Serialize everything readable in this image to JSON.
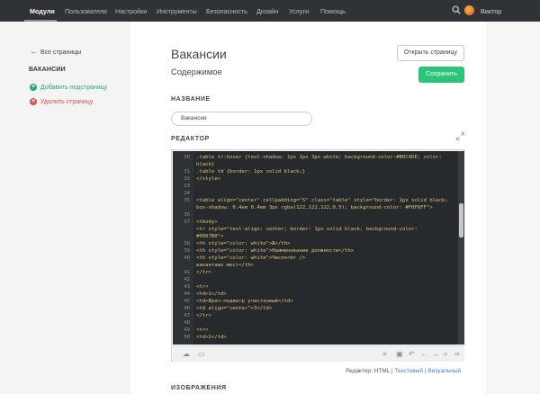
{
  "topnav": {
    "items": [
      "Модули",
      "Пользователи",
      "Настройки",
      "Инструменты",
      "Безопасность",
      "Дизайн",
      "Услуги",
      "Помощь"
    ],
    "active": "Модули",
    "user": "Виктор"
  },
  "sidebar": {
    "back": "Все страницы",
    "title": "ВАКАНСИИ",
    "add": "Добавить подстраницу",
    "delete": "Удалить страницу"
  },
  "page": {
    "title": "Вакансии",
    "subtitle": "Содержимое",
    "open_button": "Открыть страницу",
    "save_button": "Сохранить",
    "name_label": "НАЗВАНИЕ",
    "name_value": "Вакансии",
    "editor_label": "РЕДАКТОР",
    "images_label": "ИЗОБРАЖЕНИЯ"
  },
  "editor": {
    "lines": [
      {
        "n": "30",
        "t": ".table tr:hover {text-shadow: 1px 1px 3px white; background-color:#B0C4DE; color:"
      },
      {
        "n": "",
        "t": "black}"
      },
      {
        "n": "31",
        "t": ".table td {border: 1px solid black;}"
      },
      {
        "n": "32",
        "t": "</style>"
      },
      {
        "n": "33",
        "t": ""
      },
      {
        "n": "34",
        "t": ""
      },
      {
        "n": "35",
        "t": "<table align=\"center\" cellpadding=\"5\" class=\"table\" style=\"border: 1px solid black;"
      },
      {
        "n": "",
        "t": "box-shadow: 0.4em 0.4em 3px rgba(122,122,122,0.5); background-color: #F0F8FF\">"
      },
      {
        "n": "36",
        "t": ""
      },
      {
        "n": "37",
        "t": " <tbody>"
      },
      {
        "n": "",
        "t": " <tr style=\"text-align: center; border: 1px solid black; background-color:"
      },
      {
        "n": "",
        "t": "#0067B0\">"
      },
      {
        "n": "38",
        "t": "    <th style=\"color: white\">№</th>"
      },
      {
        "n": "39",
        "t": " <th style=\"color: white\">Наименование должности</th>"
      },
      {
        "n": "40",
        "t": " <th style=\"color: white\">Число<br />"
      },
      {
        "n": "",
        "t": " вакантных мест</th>"
      },
      {
        "n": "41",
        "t": " </tr>"
      },
      {
        "n": "42",
        "t": ""
      },
      {
        "n": "43",
        "t": " <tr>"
      },
      {
        "n": "44",
        "t": "    <td>1</td>"
      },
      {
        "n": "45",
        "t": " <td>Врач-педиатр участковый</td>"
      },
      {
        "n": "46",
        "t": " <td align=\"center\">3</td>"
      },
      {
        "n": "47",
        "t": " </tr>"
      },
      {
        "n": "48",
        "t": ""
      },
      {
        "n": "49",
        "t": " <tr>"
      },
      {
        "n": "50",
        "t": "    <td>2</td>"
      }
    ],
    "mode_label": "Редактор:",
    "mode_html": "HTML",
    "mode_text": "Текстовый",
    "mode_visual": "Визуальный",
    "sep": "|"
  },
  "colors": {
    "topbar": "#2f3236",
    "accent_green": "#2cc47a",
    "danger_red": "#d94c4c",
    "link_blue": "#3f7fd8",
    "code_bg": "#262a2d"
  }
}
